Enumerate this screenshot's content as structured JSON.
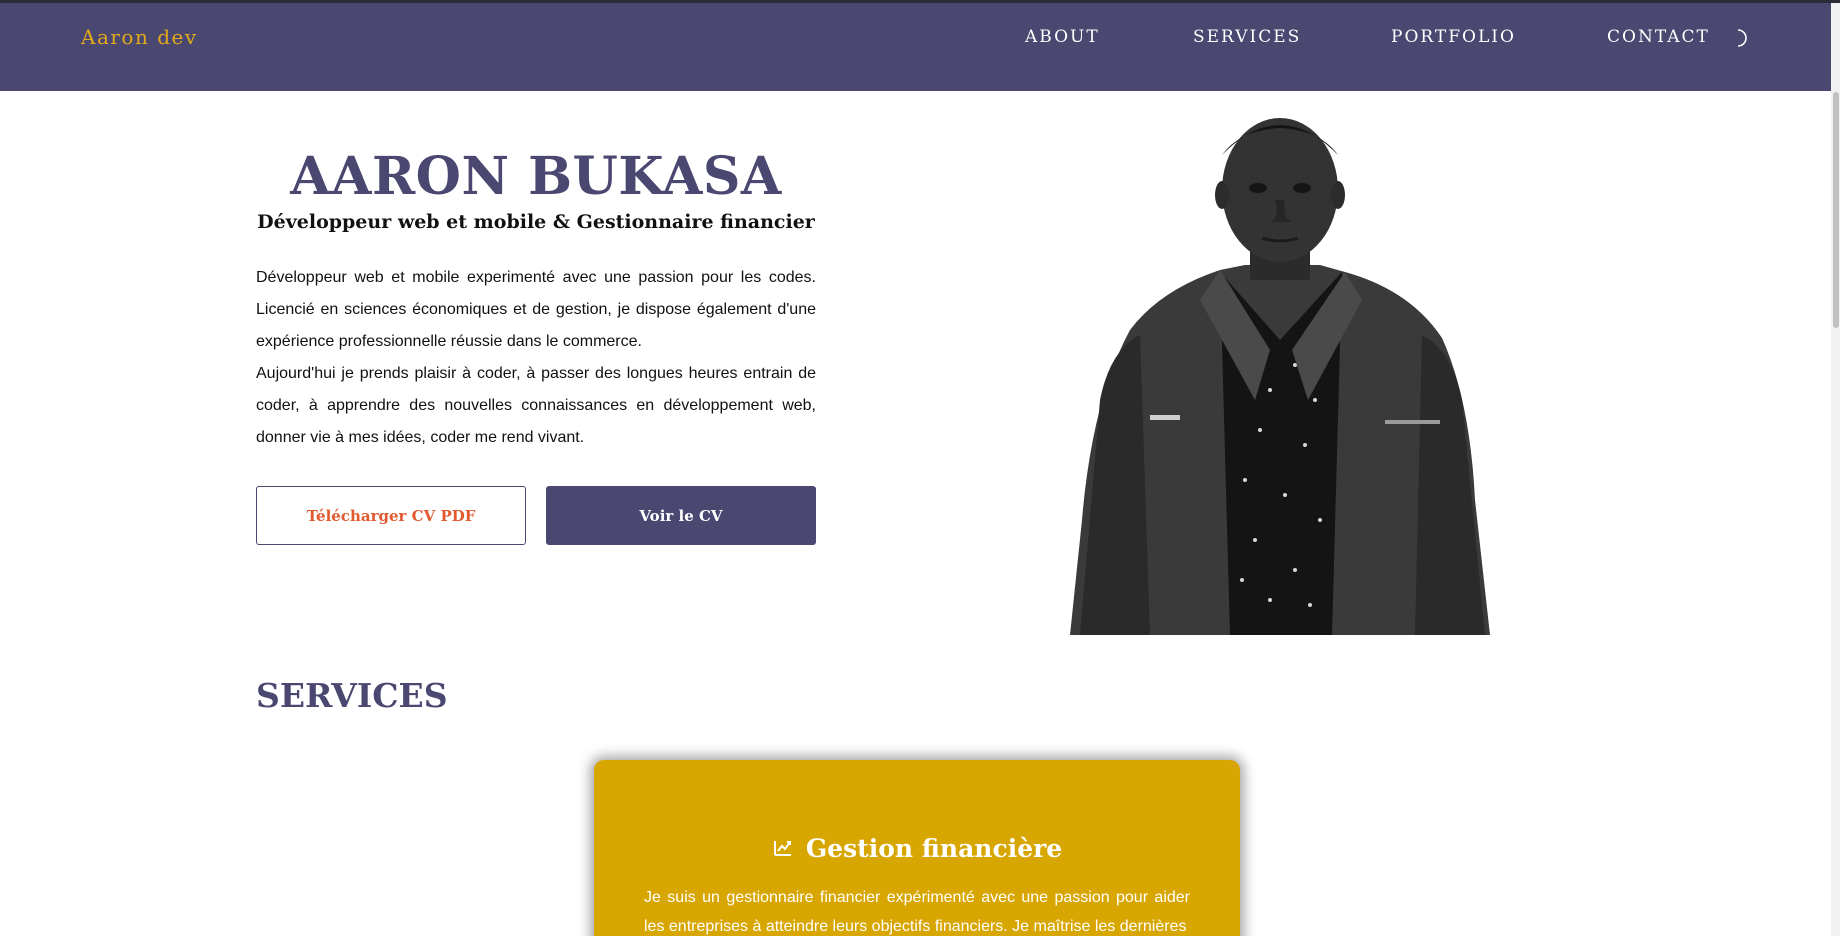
{
  "nav": {
    "brand": "Aaron dev",
    "links": [
      "ABOUT",
      "SERVICES",
      "PORTFOLIO",
      "CONTACT"
    ],
    "theme_icon": "moon-icon"
  },
  "hero": {
    "name": "AARON BUKASA",
    "role": "Développeur web et mobile & Gestionnaire financier",
    "bio_1": "Développeur web et mobile experimenté avec une passion pour les codes. Licencié en sciences économiques et de gestion, je dispose également d'une expérience professionnelle réussie dans le commerce.",
    "bio_2": "Aujourd'hui je prends plaisir à coder, à passer des longues heures entrain de coder, à apprendre des nouvelles connaissances en développement web, donner vie à mes idées, coder me rend vivant.",
    "download_button": "Télécharger CV PDF",
    "view_button": "Voir le CV"
  },
  "services": {
    "title": "SERVICES",
    "card": {
      "icon": "finance-chart-icon",
      "title": "Gestion financière",
      "description": "Je suis un gestionnaire financier expérimenté avec une passion pour aider les entreprises à atteindre leurs objectifs financiers. Je maîtrise les dernières"
    }
  },
  "colors": {
    "primary": "#4a4771",
    "brand": "#e2a91a",
    "download_text": "#e2592f",
    "card": "#d8a600"
  }
}
